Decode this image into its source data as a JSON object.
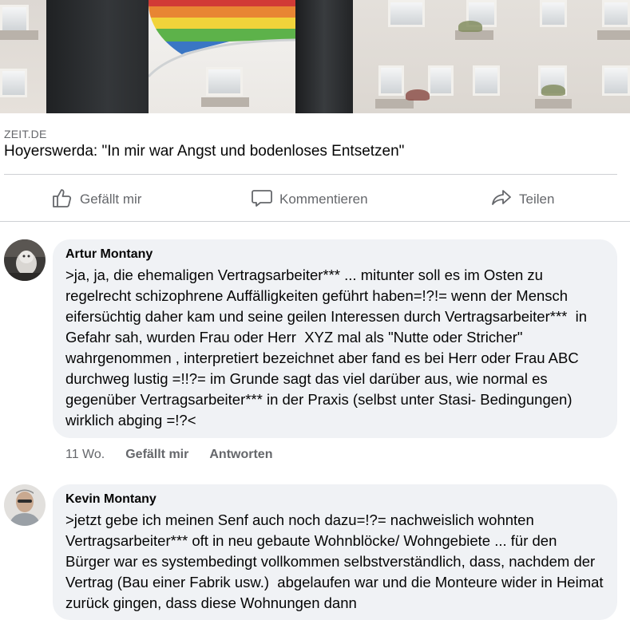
{
  "link_preview": {
    "domain": "ZEIT.DE",
    "title": "Hoyerswerda: \"In mir war Angst und bodenloses Entsetzen\""
  },
  "actions": {
    "like": "Gefällt mir",
    "comment": "Kommentieren",
    "share": "Teilen"
  },
  "comments": [
    {
      "author": "Artur Montany",
      "text": ">ja, ja, die ehemaligen Vertragsarbeiter*** ... mitunter soll es im Osten zu regelrecht schizophrene Auffälligkeiten geführt haben=!?!= wenn der Mensch eifersüchtig daher kam und seine geilen Interessen durch Vertragsarbeiter***  in Gefahr sah, wurden Frau oder Herr  XYZ mal als \"Nutte oder Stricher\" wahrgenommen , interpretiert bezeichnet aber fand es bei Herr oder Frau ABC durchweg lustig =!!?= im Grunde sagt das viel darüber aus, wie normal es gegenüber Vertragsarbeiter*** in der Praxis (selbst unter Stasi- Bedingungen)  wirklich abging =!?<",
      "time": "11 Wo.",
      "like_label": "Gefällt mir",
      "reply_label": "Antworten"
    },
    {
      "author": "Kevin Montany",
      "text": ">jetzt gebe ich meinen Senf auch noch dazu=!?= nachweislich wohnten Vertragsarbeiter*** oft in neu gebaute Wohnblöcke/ Wohngebiete ... für den Bürger war es systembedingt vollkommen selbstverständlich, dass, nachdem der Vertrag (Bau einer Fabrik usw.)  abgelaufen war und die Monteure wider in Heimat zurück gingen, dass diese Wohnungen dann"
    }
  ],
  "icons": {
    "like": "thumbs-up-icon",
    "comment": "speech-bubble-icon",
    "share": "share-arrow-icon"
  },
  "colors": {
    "secondary_text": "#65676b",
    "bubble_bg": "#f0f2f5",
    "divider": "#ced0d4"
  }
}
